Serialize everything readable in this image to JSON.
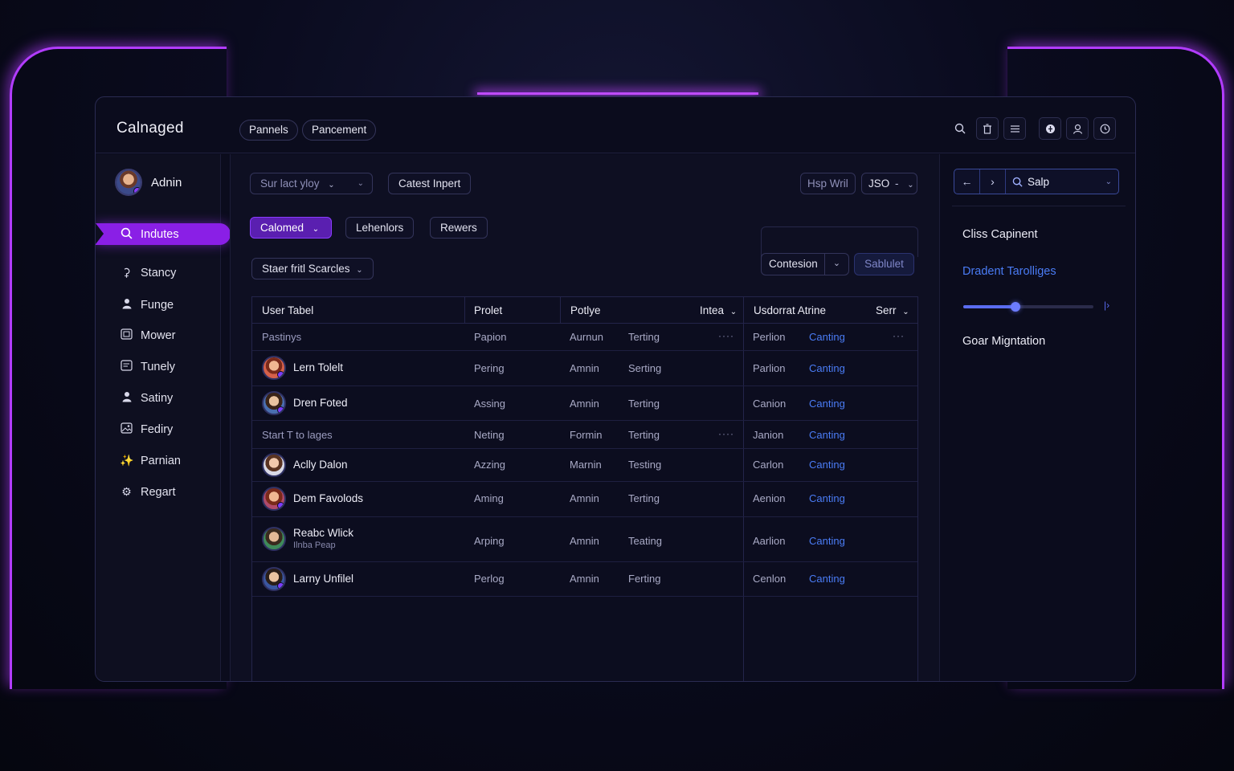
{
  "app": {
    "title": "Calnaged"
  },
  "header": {
    "tabs": [
      {
        "label": "Pannels"
      },
      {
        "label": "Pancement"
      }
    ],
    "icons": [
      "search-icon",
      "trash-icon",
      "list-icon",
      "shield-icon",
      "user-icon",
      "clock-icon"
    ]
  },
  "sidebar": {
    "user": {
      "name": "Adnin"
    },
    "active": {
      "label": "Indutes",
      "icon": "search-icon"
    },
    "items": [
      {
        "label": "Stancy",
        "icon": "user-outline-icon"
      },
      {
        "label": "Funge",
        "icon": "person-icon"
      },
      {
        "label": "Mower",
        "icon": "image-icon"
      },
      {
        "label": "Tunely",
        "icon": "card-icon"
      },
      {
        "label": "Satiny",
        "icon": "person-icon"
      },
      {
        "label": "Fediry",
        "icon": "gallery-icon"
      },
      {
        "label": "Parnian",
        "icon": "sparkle-icon"
      },
      {
        "label": "Regart",
        "icon": "gear-icon"
      }
    ]
  },
  "toolbar": {
    "select_label": "Sur lact yloy",
    "import_label": "Catest Inpert",
    "help_label": "Hsp Wril",
    "format_label": "JSO",
    "filters": [
      {
        "label": "Calomed"
      },
      {
        "label": "Lehenlors"
      },
      {
        "label": "Rewers"
      }
    ],
    "scope_label": "Staer fritl Scarcles",
    "contesion_label": "Contesion",
    "submit_label": "Sablulet"
  },
  "table": {
    "headers": [
      "User Tabel",
      "Prolet",
      "Potlye",
      "Intea",
      "Usdorrat Atrine",
      "Serr"
    ],
    "rows": [
      {
        "kind": "group",
        "name": "Pastinys",
        "c2": "Papion",
        "c3": "Aurnun",
        "c4": "Terting",
        "c5": "Perlion",
        "c6": "Canting"
      },
      {
        "kind": "user",
        "name": "Lern Tolelt",
        "c2": "Pering",
        "c3": "Amnin",
        "c4": "Serting",
        "c5": "Parlion",
        "c6": "Canting"
      },
      {
        "kind": "user",
        "name": "Dren Foted",
        "c2": "Assing",
        "c3": "Amnin",
        "c4": "Terting",
        "c5": "Canion",
        "c6": "Canting"
      },
      {
        "kind": "group",
        "name": "Start T to lages",
        "c2": "Neting",
        "c3": "Formin",
        "c4": "Terting",
        "c5": "Janion",
        "c6": "Canting"
      },
      {
        "kind": "user",
        "name": "Aclly Dalon",
        "c2": "Azzing",
        "c3": "Marnin",
        "c4": "Testing",
        "c5": "Carlon",
        "c6": "Canting"
      },
      {
        "kind": "user",
        "name": "Dem Favolods",
        "c2": "Aming",
        "c3": "Amnin",
        "c4": "Terting",
        "c5": "Aenion",
        "c6": "Canting"
      },
      {
        "kind": "user",
        "name": "Reabc Wlick",
        "sub": "Ilnba Peap",
        "c2": "Arping",
        "c3": "Amnin",
        "c4": "Teating",
        "c5": "Aarlion",
        "c6": "Canting"
      },
      {
        "kind": "user",
        "name": "Larny Unfilel",
        "c2": "Perlog",
        "c3": "Amnin",
        "c4": "Ferting",
        "c5": "Cenlon",
        "c6": "Canting"
      }
    ]
  },
  "right_panel": {
    "search_label": "Salp",
    "class_label": "Cliss Capinent",
    "gradient_label": "Dradent Tarolliges",
    "migration_label": "Goar Migntation",
    "slider_value": 0.4
  },
  "colors": {
    "accent": "#8a1fe6",
    "neon": "#b23cff",
    "link": "#4a7cf5"
  }
}
